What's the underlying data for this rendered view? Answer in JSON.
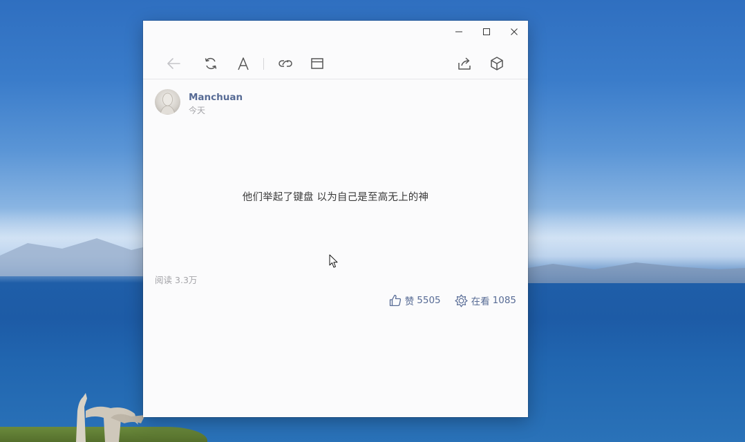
{
  "window": {
    "controls": {
      "minimize_icon": "minimize-icon",
      "maximize_icon": "maximize-icon",
      "close_icon": "close-icon"
    }
  },
  "toolbar": {
    "left_icons": [
      "back-arrow-icon",
      "refresh-icon",
      "font-size-icon",
      "link-icon",
      "open-window-icon"
    ],
    "right_icons": [
      "share-icon",
      "cube-icon"
    ]
  },
  "article": {
    "author_name": "Manchuan",
    "date": "今天",
    "body": "他们举起了键盘 以为自己是至高无上的神",
    "reads_label": "阅读",
    "reads_count": "3.3万"
  },
  "actions": {
    "like_label": "赞",
    "like_count": "5505",
    "wow_label": "在看",
    "wow_count": "1085"
  },
  "colors": {
    "link_blue": "#576b95",
    "muted_gray": "#a4a4a8",
    "window_bg": "#fbfbfc"
  }
}
